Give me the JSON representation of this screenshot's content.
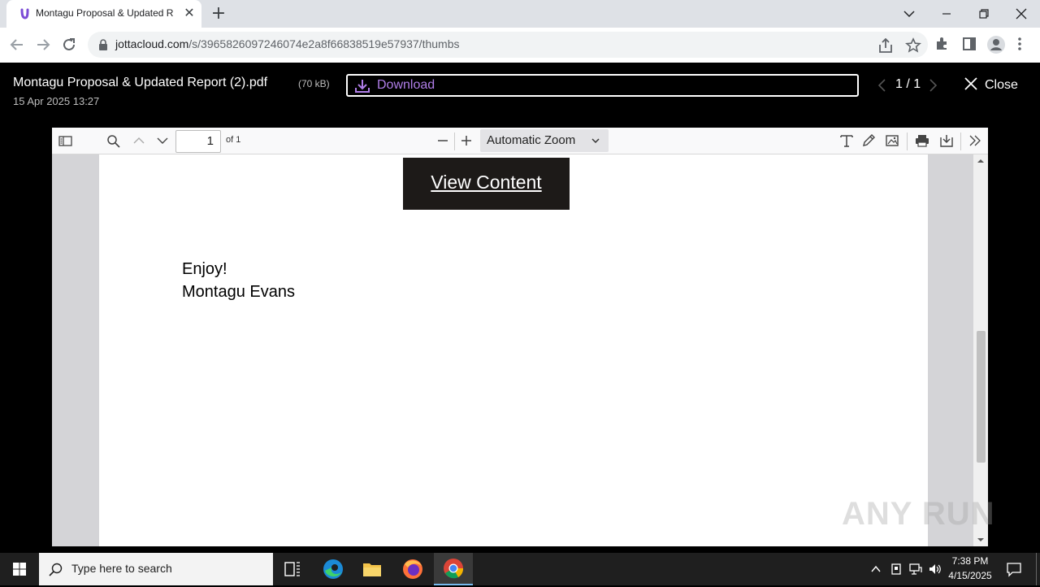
{
  "browser": {
    "tab_title": "Montagu Proposal & Updated R",
    "url_host": "jottacloud.com",
    "url_path": "/s/3965826097246074e2a8f66838519e57937/thumbs"
  },
  "viewer": {
    "file_title": "Montagu Proposal & Updated Report (2).pdf",
    "file_size": "(70 kB)",
    "file_date": "15 Apr 2025 13:27",
    "download_label": "Download",
    "pager": "1 / 1",
    "close_label": "Close",
    "accent_color": "#b07ee8"
  },
  "pdf": {
    "page_number": "1",
    "page_of": "of 1",
    "zoom": "Automatic Zoom",
    "view_content_label": "View Content",
    "enjoy": "Enjoy!",
    "signature": "Montagu Evans"
  },
  "taskbar": {
    "search_placeholder": "Type here to search",
    "time": "7:38 PM",
    "date": "4/15/2025"
  },
  "watermark": "ANY RUN"
}
